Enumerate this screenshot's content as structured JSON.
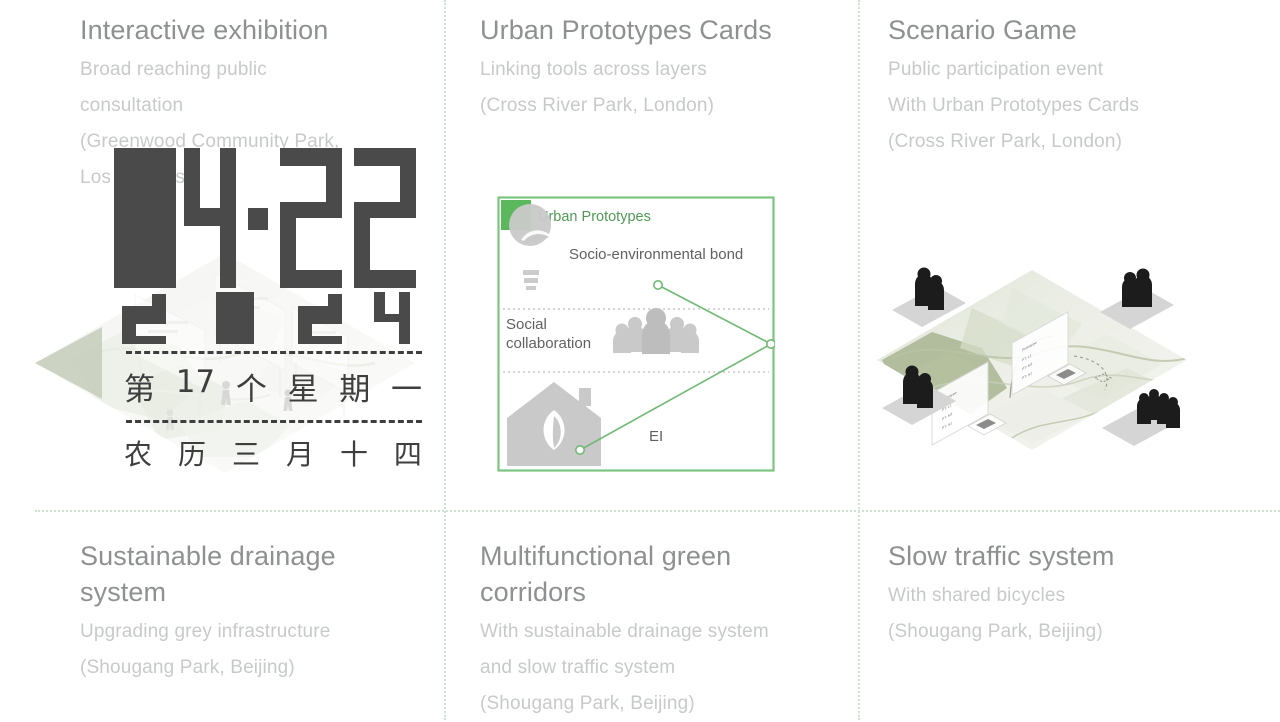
{
  "palette": {
    "title_grey": "#8e9091",
    "body_grey": "#c7cac9",
    "divider_green": "#cfe3d2",
    "accent_green": "#5cb85c",
    "card_border_green": "#7cc47f",
    "digit_dark": "#4a4a4a",
    "olive_green": "#8d9b77",
    "icon_grey": "#c9c9c9",
    "background": "#ffffff"
  },
  "cells": {
    "interactive_exhibition": {
      "title": "Interactive exhibition",
      "subtitle": "Broad reaching public\nconsultation\n(Greenwood Community Park,\nLos Angeles)"
    },
    "urban_prototypes_cards": {
      "title": "Urban Prototypes Cards",
      "subtitle": "Linking tools across layers\n(Cross River Park, London)"
    },
    "scenario_game": {
      "title": "Scenario Game",
      "subtitle": "Public participation event\nWith Urban Prototypes Cards\n(Cross River Park, London)"
    },
    "sustainable_drainage": {
      "title": "Sustainable drainage\nsystem",
      "subtitle": "Upgrading grey infrastructure\n(Shougang Park, Beijing)"
    },
    "green_corridors": {
      "title": "Multifunctional green\ncorridors",
      "subtitle": "With sustainable drainage system\nand slow traffic system\n(Shougang Park, Beijing)"
    },
    "slow_traffic": {
      "title": "Slow traffic system",
      "subtitle": "With shared bicycles\n(Shougang Park, Beijing)"
    }
  },
  "calendar": {
    "month": "04",
    "separator": "·",
    "day": "22",
    "year": "2024",
    "weekday_line": [
      "第",
      "17",
      "个",
      "星",
      "期",
      "一"
    ],
    "lunar_line": [
      "农",
      "历",
      "三",
      "月",
      "十",
      "四"
    ]
  },
  "prototypes_card": {
    "header": "Urban Prototypes",
    "rows": [
      {
        "label": "Socio-environmental bond",
        "icon": "lightbulb-leaf-icon"
      },
      {
        "label": "Social\ncollaboration",
        "icon": "people-group-icon"
      },
      {
        "label": "EI",
        "icon": "house-leaf-icon"
      }
    ]
  },
  "scenario_board": {
    "prototype_cards": [
      {
        "title": "Prototype",
        "lines": [
          "PT: L1",
          "PT: M1",
          "PT: S1"
        ]
      },
      {
        "title": "Prototype",
        "lines": [
          "PT: L1",
          "PT: M1",
          "PT: S1"
        ]
      }
    ],
    "actor_groups": [
      "person-pair-top-left",
      "person-pair-bottom-left",
      "person-pair-top-right",
      "crowd-bottom-right"
    ]
  }
}
